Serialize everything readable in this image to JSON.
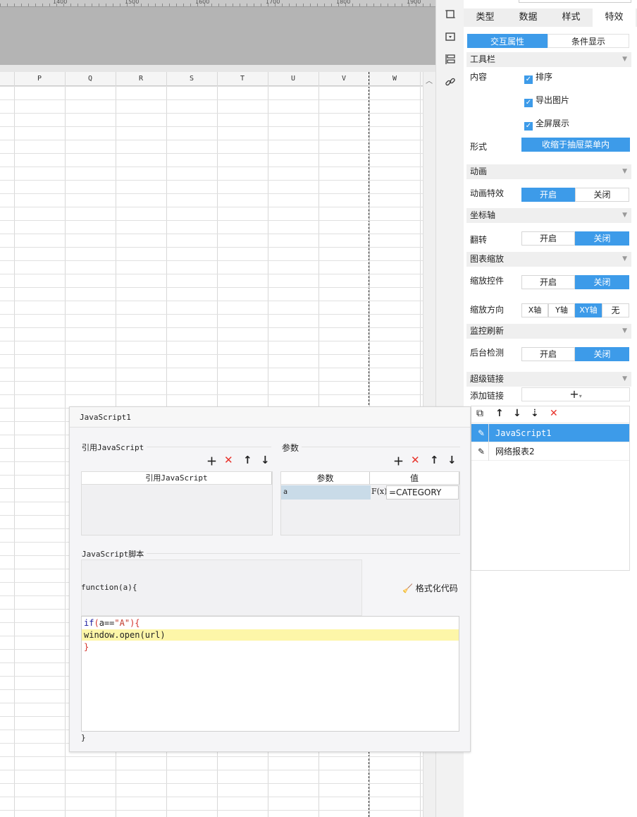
{
  "ruler": {
    "labels": [
      "1400",
      "1500",
      "1600",
      "1700",
      "1800",
      "1900"
    ]
  },
  "columns": [
    "P",
    "Q",
    "R",
    "S",
    "T",
    "U",
    "V",
    "W"
  ],
  "sidebar_icons": [
    "resize-icon",
    "dropdown-icon",
    "layout-icon",
    "link-icon"
  ],
  "panel": {
    "tabs": [
      "类型",
      "数据",
      "样式",
      "特效"
    ],
    "active_tab": "特效",
    "subtabs": [
      "交互属性",
      "条件显示"
    ],
    "toolbar": {
      "section": "工具栏",
      "content_label": "内容",
      "options": [
        "排序",
        "导出图片",
        "全屏展示"
      ],
      "form_label": "形式",
      "form_value": "收缩于抽屉菜单内"
    },
    "animation": {
      "section": "动画",
      "label": "动画特效",
      "on": "开启",
      "off": "关闭",
      "selected": "开启"
    },
    "axis": {
      "section": "坐标轴",
      "label": "翻转",
      "on": "开启",
      "off": "关闭",
      "selected": "关闭"
    },
    "zoom": {
      "section": "图表缩放",
      "control_label": "缩放控件",
      "on": "开启",
      "off": "关闭",
      "control_selected": "关闭",
      "direction_label": "缩放方向",
      "directions": [
        "X轴",
        "Y轴",
        "XY轴",
        "无"
      ],
      "direction_selected": "XY轴"
    },
    "monitor": {
      "section": "监控刷新",
      "label": "后台检测",
      "on": "开启",
      "off": "关闭",
      "selected": "关闭"
    },
    "hyperlink": {
      "section": "超级链接",
      "add_label": "添加链接",
      "add_symbol": "+",
      "items": [
        "JavaScript1",
        "网络报表2"
      ],
      "selected": "JavaScript1"
    }
  },
  "dialog": {
    "title": "JavaScript1",
    "ref_group": "引用JavaScript",
    "ref_header": "引用JavaScript",
    "param_group": "参数",
    "param_headers": [
      "参数",
      "值"
    ],
    "param_name": "a",
    "param_value": "=CATEGORY",
    "fx_label": "F(x)",
    "script_group": "JavaScript脚本",
    "fn_signature": "function(a){",
    "format_label": "格式化代码",
    "code": {
      "line1": {
        "kw": "if",
        "p1": "(",
        "mid": "a==",
        "str": "\"A\"",
        "p2": "){"
      },
      "line2": "window.open(url)",
      "line3": "}"
    },
    "closing": "}"
  },
  "colors": {
    "accent": "#3d9be9",
    "danger": "#e8332b",
    "highlight": "#fdf6a8"
  }
}
